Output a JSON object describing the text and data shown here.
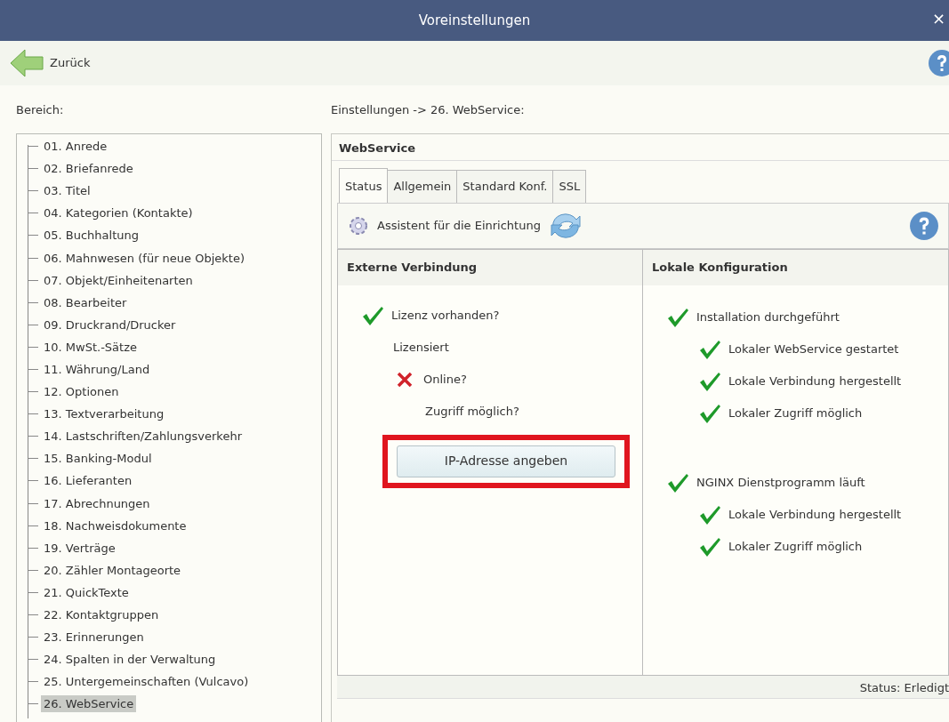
{
  "window": {
    "title": "Voreinstellungen",
    "close": "×"
  },
  "toolbar": {
    "back": "Zurück"
  },
  "sidebar": {
    "label": "Bereich:",
    "items": [
      {
        "label": "01. Anrede",
        "selected": false
      },
      {
        "label": "02. Briefanrede",
        "selected": false
      },
      {
        "label": "03. Titel",
        "selected": false
      },
      {
        "label": "04. Kategorien (Kontakte)",
        "selected": false
      },
      {
        "label": "05. Buchhaltung",
        "selected": false
      },
      {
        "label": "06. Mahnwesen (für neue Objekte)",
        "selected": false
      },
      {
        "label": "07. Objekt/Einheitenarten",
        "selected": false
      },
      {
        "label": "08. Bearbeiter",
        "selected": false
      },
      {
        "label": "09. Druckrand/Drucker",
        "selected": false
      },
      {
        "label": "10. MwSt.-Sätze",
        "selected": false
      },
      {
        "label": "11. Währung/Land",
        "selected": false
      },
      {
        "label": "12. Optionen",
        "selected": false
      },
      {
        "label": "13. Textverarbeitung",
        "selected": false
      },
      {
        "label": "14. Lastschriften/Zahlungsverkehr",
        "selected": false
      },
      {
        "label": "15. Banking-Modul",
        "selected": false
      },
      {
        "label": "16. Lieferanten",
        "selected": false
      },
      {
        "label": "17. Abrechnungen",
        "selected": false
      },
      {
        "label": "18. Nachweisdokumente",
        "selected": false
      },
      {
        "label": "19. Verträge",
        "selected": false
      },
      {
        "label": "20. Zähler Montageorte",
        "selected": false
      },
      {
        "label": "21. QuickTexte",
        "selected": false
      },
      {
        "label": "22. Kontaktgruppen",
        "selected": false
      },
      {
        "label": "23. Erinnerungen",
        "selected": false
      },
      {
        "label": "24. Spalten in der Verwaltung",
        "selected": false
      },
      {
        "label": "25. Untergemeinschaften (Vulcavo)",
        "selected": false
      },
      {
        "label": "26. WebService",
        "selected": true
      }
    ]
  },
  "breadcrumb": "Einstellungen -> 26. WebService:",
  "panel": {
    "title": "WebService",
    "tabs": [
      {
        "label": "Status",
        "selected": true
      },
      {
        "label": "Allgemein",
        "selected": false
      },
      {
        "label": "Standard Konf.",
        "selected": false
      },
      {
        "label": "SSL",
        "selected": false
      }
    ],
    "assistant": "Assistent für die Einrichtung",
    "columns": [
      {
        "title": "Externe Verbindung",
        "items": [
          {
            "label": "Lizenz vorhanden?",
            "kind": "check",
            "children": [
              {
                "label": "Lizensiert"
              },
              {
                "label": "Online?",
                "kind": "cross",
                "children": [
                  {
                    "label": "Zugriff möglich?"
                  }
                ]
              }
            ]
          }
        ],
        "button": {
          "label": "IP-Adresse angeben",
          "highlighted": true
        }
      },
      {
        "title": "Lokale Konfiguration",
        "items": [
          {
            "label": "Installation durchgeführt",
            "kind": "check",
            "children": [
              {
                "label": "Lokaler WebService gestartet",
                "kind": "check"
              },
              {
                "label": "Lokale Verbindung hergestellt",
                "kind": "check"
              },
              {
                "label": "Lokaler Zugriff möglich",
                "kind": "check"
              }
            ]
          },
          {
            "label": "NGINX Dienstprogramm läuft",
            "kind": "check",
            "children": [
              {
                "label": "Lokale Verbindung hergestellt",
                "kind": "check"
              },
              {
                "label": "Lokaler Zugriff möglich",
                "kind": "check"
              }
            ]
          }
        ]
      }
    ],
    "status_bar": "Status: Erledigt"
  }
}
